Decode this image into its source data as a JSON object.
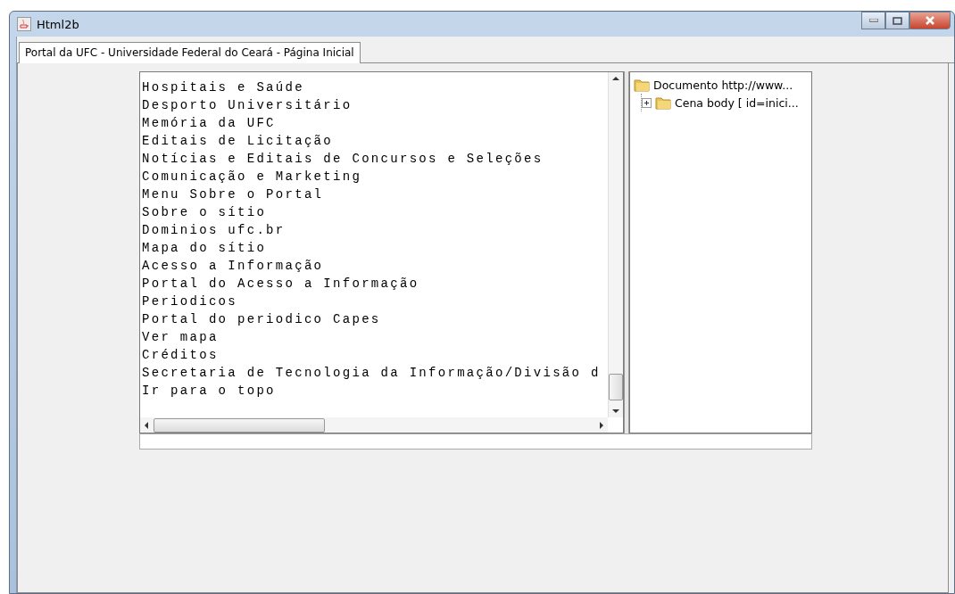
{
  "window": {
    "title": "Html2b"
  },
  "tabs": [
    {
      "label": "Portal da UFC - Universidade Federal do Ceará - Página Inicial",
      "selected": true
    }
  ],
  "text_area": {
    "lines": [
      "Hospitais e Saúde",
      "Desporto Universitário",
      "Memória da UFC",
      "Editais de Licitação",
      "Notícias e Editais de Concursos e Seleções",
      "Comunicação e Marketing",
      "Menu Sobre o Portal",
      "Sobre o sítio",
      "Dominios ufc.br",
      "Mapa do sítio",
      "Acesso a Informação",
      "Portal do Acesso a Informação",
      "Periodicos",
      "Portal do periodico Capes",
      "Ver mapa",
      "Créditos",
      "Secretaria de Tecnologia da Informação/Divisão d",
      "Ir para o topo"
    ]
  },
  "tree": {
    "items": [
      {
        "label": "Documento http://www...",
        "expanded": true,
        "children": [
          {
            "label": "Cena body [ id=inici...",
            "expanded": false
          }
        ]
      }
    ]
  }
}
